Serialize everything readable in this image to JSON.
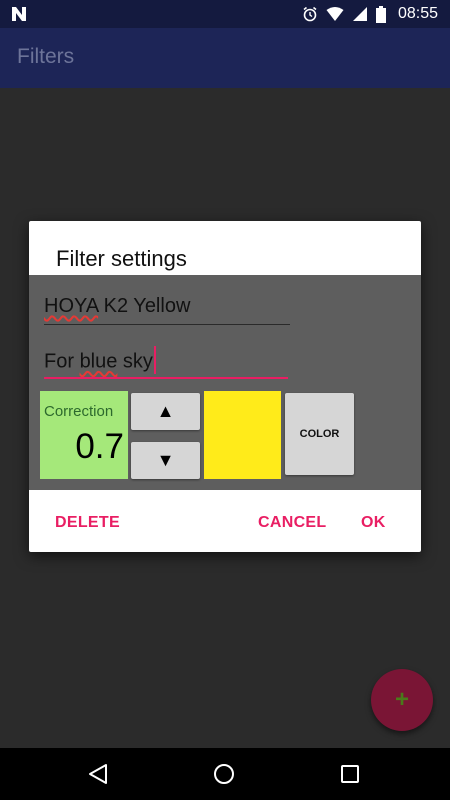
{
  "status_bar": {
    "time": "08:55",
    "icons": [
      "n-notification-icon",
      "alarm-icon",
      "wifi-icon",
      "signal-icon",
      "battery-icon"
    ]
  },
  "app_bar": {
    "title": "Filters"
  },
  "dialog": {
    "title": "Filter settings",
    "filter_name": "HOYA K2 Yellow",
    "filter_name_parts": [
      "HOYA",
      " K2 Yellow"
    ],
    "description": "For blue sky",
    "description_parts": [
      "For ",
      "blue",
      " sky"
    ],
    "correction_label": "Correction",
    "correction_value": "0.7",
    "up_label": "▲",
    "down_label": "▼",
    "swatch_color": "#ffeb1a",
    "color_button_label": "COLOR",
    "delete_label": "DELETE",
    "cancel_label": "CANCEL",
    "ok_label": "OK"
  },
  "fab": {
    "icon": "plus-icon",
    "label": "+"
  },
  "nav_bar": {
    "icons": [
      "back-icon",
      "home-icon",
      "recents-icon"
    ]
  },
  "colors": {
    "accent": "#e91e63",
    "app_bar": "#1d2557",
    "status_bar": "#141a3f",
    "fab": "#7a1535",
    "correction_bg": "#a5e87a"
  }
}
